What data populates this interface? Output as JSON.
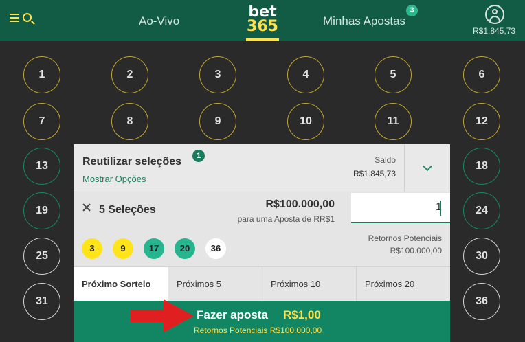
{
  "header": {
    "nav_live": "Ao-Vivo",
    "logo_top": "bet",
    "logo_bottom": "365",
    "nav_bets": "Minhas Apostas",
    "bets_badge": "3",
    "balance": "R$1.845,73"
  },
  "balls": [
    {
      "n": "1",
      "style": "gold"
    },
    {
      "n": "2",
      "style": "gold"
    },
    {
      "n": "3",
      "style": "gold"
    },
    {
      "n": "4",
      "style": "gold"
    },
    {
      "n": "5",
      "style": "gold"
    },
    {
      "n": "6",
      "style": "gold"
    },
    {
      "n": "7",
      "style": "gold"
    },
    {
      "n": "8",
      "style": "gold"
    },
    {
      "n": "9",
      "style": "gold"
    },
    {
      "n": "10",
      "style": "gold"
    },
    {
      "n": "11",
      "style": "gold"
    },
    {
      "n": "12",
      "style": "gold"
    },
    {
      "n": "13",
      "style": "green"
    },
    {
      "n": "18",
      "style": "green"
    },
    {
      "n": "19",
      "style": "green"
    },
    {
      "n": "24",
      "style": "green"
    },
    {
      "n": "25",
      "style": "grey"
    },
    {
      "n": "30",
      "style": "grey"
    },
    {
      "n": "31",
      "style": "grey"
    },
    {
      "n": "36",
      "style": "grey"
    }
  ],
  "slip": {
    "reuse_title": "Reutilizar seleções",
    "reuse_badge": "1",
    "show_options": "Mostrar Opções",
    "saldo_label": "Saldo",
    "saldo_value": "R$1.845,73",
    "selections_label": "5 Seleções",
    "amount": "R$100.000,00",
    "amount_note": "para uma Aposta de RR$1",
    "stake_value": "1",
    "chips": [
      {
        "n": "3",
        "color": "yellow"
      },
      {
        "n": "9",
        "color": "yellow"
      },
      {
        "n": "17",
        "color": "teal"
      },
      {
        "n": "20",
        "color": "teal"
      },
      {
        "n": "36",
        "color": "white"
      }
    ],
    "returns_label": "Retornos Potenciais",
    "returns_value": "R$100.000,00",
    "tabs": [
      "Próximo Sorteio",
      "Próximos 5",
      "Próximos 10",
      "Próximos 20"
    ],
    "place_label": "Fazer aposta",
    "place_amount": "R$1,00",
    "place_sub": "Retornos Potenciais R$100.000,00"
  },
  "colors": {
    "header_bg": "#125c46",
    "accent_yellow": "#ffe14d",
    "place_bet_bg": "#128563",
    "arrow_red": "#e02020"
  }
}
